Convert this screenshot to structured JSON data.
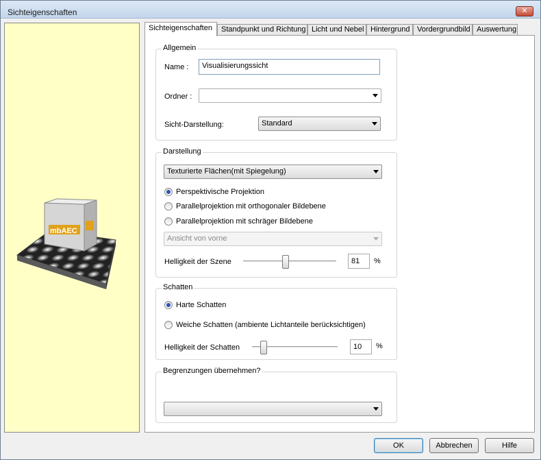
{
  "window": {
    "title": "Sichteigenschaften",
    "close_glyph": "✕"
  },
  "tabs": [
    {
      "label": "Sichteigenschaften",
      "active": true
    },
    {
      "label": "Standpunkt und Richtung"
    },
    {
      "label": "Licht und Nebel"
    },
    {
      "label": "Hintergrund"
    },
    {
      "label": "Vordergrundbild"
    },
    {
      "label": "Auswertung"
    }
  ],
  "preview": {
    "background": "#ffffc6",
    "logo_text": "mbAEC",
    "icon": "scene-preview-icon"
  },
  "allgemein": {
    "title": "Allgemein",
    "name_label": "Name :",
    "name_value": "Visualisierungssicht",
    "ordner_label": "Ordner :",
    "ordner_value": "",
    "sicht_label": "Sicht-Darstellung:",
    "sicht_value": "Standard"
  },
  "darstellung": {
    "title": "Darstellung",
    "mode_value": "Texturierte Flächen(mit Spiegelung)",
    "projections": [
      {
        "label": "Perspektivische Projektion",
        "selected": true
      },
      {
        "label": "Parallelprojektion mit orthogonaler Bildebene",
        "selected": false
      },
      {
        "label": "Parallelprojektion mit schräger Bildebene",
        "selected": false
      }
    ],
    "view_value": "Ansicht von vorne",
    "brightness_label": "Helligkeit der Szene",
    "brightness_value": "81",
    "brightness_level": 0.45,
    "unit": "%"
  },
  "schatten": {
    "title": "Schatten",
    "options": [
      {
        "label": "Harte Schatten",
        "selected": true
      },
      {
        "label": "Weiche Schatten (ambiente Lichtanteile berücksichtigen)",
        "selected": false
      }
    ],
    "brightness_label": "Helligkeit der Schatten",
    "brightness_value": "10",
    "brightness_level": 0.1,
    "unit": "%"
  },
  "begrenzungen": {
    "title": "Begrenzungen übernehmen?",
    "value": ""
  },
  "footer": {
    "ok": "OK",
    "cancel": "Abbrechen",
    "help": "Hilfe"
  }
}
